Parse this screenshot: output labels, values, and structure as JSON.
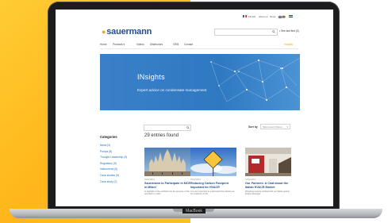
{
  "topbar": {
    "items": [
      "FR",
      "EN",
      "About us",
      "News",
      "Contact"
    ]
  },
  "header": {
    "logo_text": "sauermann",
    "cart_label": "See and find (0)"
  },
  "nav": {
    "items": [
      "Home",
      "Products",
      "Videos",
      "Distributors",
      "OEM",
      "Contact"
    ],
    "products_chevron": "▾",
    "insights": "Insights"
  },
  "hero": {
    "title": "INsights",
    "subtitle": "Expert advice on condensate management"
  },
  "listing": {
    "entries_found": "29 entries found",
    "sort_label": "Sort by",
    "sort_value": "Most recent (Desc...",
    "sort_chevron": "▾"
  },
  "categories": {
    "title": "Categories",
    "items": [
      "News (4)",
      "Pumps (8)",
      "Thought Leadership (9)",
      "Regulatory (5)",
      "Instruments (5)",
      "Case studies (5)",
      "Case study (2)"
    ]
  },
  "cards": [
    {
      "date": "06/02/2019",
      "title": "Sauermann to Participate in MCE in Milan!",
      "excerpt": "In highlight of the exhibition for the purpose of the operation in milan"
    },
    {
      "date": "05/02/2019",
      "title": "Reducing Carbon Footprint Important for HVACR",
      "excerpt": "It is very important to understand the industry as for emissions in the"
    },
    {
      "date": "02/02/2019",
      "title": "Our Partners: A Chat about the Italian HVACR Market",
      "excerpt": "Weighing recently chatted with our Italian partner Zeppa Giuseppe"
    }
  ],
  "laptop": {
    "label": "MacBook"
  },
  "colors": {
    "brand_blue": "#1f4e8c",
    "accent_orange": "#f5a623",
    "hero_blue": "#3a80c8",
    "background_yellow": "#ffbf2a"
  }
}
